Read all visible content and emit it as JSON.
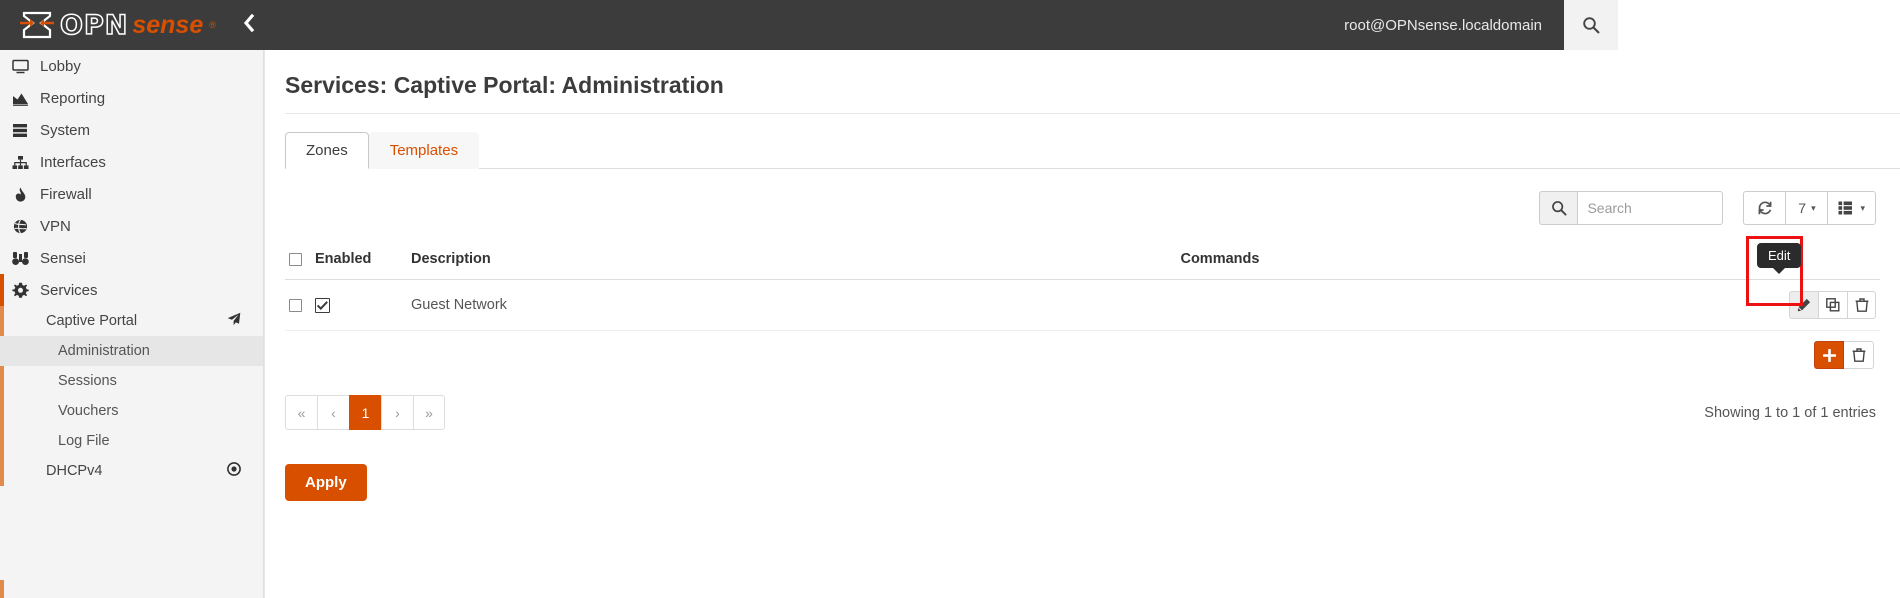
{
  "topbar": {
    "logo_opn": "OPN",
    "logo_sense": "sense",
    "logo_reg": "®",
    "collapse_icon": "chevron-left-icon",
    "user": "root@OPNsense.localdomain",
    "search_icon": "search-icon",
    "search_value": "",
    "search_placeholder": ""
  },
  "sidebar": {
    "items": [
      {
        "label": "Lobby",
        "icon": "monitor-icon"
      },
      {
        "label": "Reporting",
        "icon": "chart-area-icon"
      },
      {
        "label": "System",
        "icon": "server-icon"
      },
      {
        "label": "Interfaces",
        "icon": "sitemap-icon"
      },
      {
        "label": "Firewall",
        "icon": "fire-icon"
      },
      {
        "label": "VPN",
        "icon": "globe-icon"
      },
      {
        "label": "Sensei",
        "icon": "binoculars-icon"
      },
      {
        "label": "Services",
        "icon": "gear-icon"
      }
    ],
    "captive_portal": {
      "label": "Captive Portal",
      "icon": "paper-plane-icon"
    },
    "captive_children": [
      {
        "label": "Administration",
        "active": true
      },
      {
        "label": "Sessions",
        "active": false
      },
      {
        "label": "Vouchers",
        "active": false
      },
      {
        "label": "Log File",
        "active": false
      }
    ],
    "dhcpv4": {
      "label": "DHCPv4",
      "icon": "circle-dot-icon"
    }
  },
  "main": {
    "page_title": "Services: Captive Portal: Administration",
    "tabs": [
      {
        "label": "Zones",
        "active": true
      },
      {
        "label": "Templates",
        "active": false
      }
    ],
    "toolbar": {
      "search_icon": "search-icon",
      "search_value": "",
      "search_placeholder": "Search",
      "reload_icon": "refresh-icon",
      "page_size": "7",
      "page_size_caret": "▾",
      "columns_icon": "columns-icon",
      "columns_caret": "▾"
    },
    "table": {
      "columns": [
        "",
        "Enabled",
        "Description",
        "Commands"
      ],
      "rows": [
        {
          "selected": false,
          "enabled": true,
          "description": "Guest Network",
          "actions": [
            "edit-icon",
            "clone-icon",
            "trash-icon"
          ]
        }
      ],
      "add_button_icon": "plus-icon",
      "delete_button_icon": "trash-icon"
    },
    "tooltip": {
      "text": "Edit"
    },
    "pagination": {
      "first": "«",
      "prev": "‹",
      "pages": [
        "1"
      ],
      "next": "›",
      "last": "»",
      "active_page": "1"
    },
    "entries_text": "Showing 1 to 1 of 1 entries",
    "apply_label": "Apply"
  },
  "colors": {
    "accent": "#d94f00",
    "topbar_bg": "#3c3c3c",
    "sidebar_bg": "#f4f4f4",
    "highlight": "#ee1111",
    "tooltip_bg": "#2b2b2b"
  }
}
